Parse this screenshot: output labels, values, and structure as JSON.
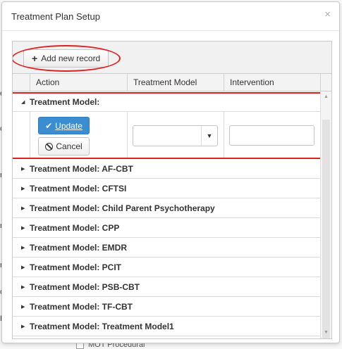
{
  "background": {
    "left_fragments": [
      "e",
      "c",
      "r",
      "n",
      "r",
      "o",
      "E"
    ],
    "bottom_label": "MOT Procedural"
  },
  "modal": {
    "title": "Treatment Plan Setup",
    "close_glyph": "×"
  },
  "toolbar": {
    "add_label": "Add new record",
    "add_glyph": "+"
  },
  "columns": [
    "Action",
    "Treatment Model",
    "Intervention"
  ],
  "edit_group": {
    "label": "Treatment Model:",
    "update_label": "Update",
    "update_glyph": "✔",
    "cancel_label": "Cancel",
    "dropdown_value": "",
    "dropdown_arrow": "▼",
    "intervention_value": ""
  },
  "groups": [
    "Treatment Model: AF-CBT",
    "Treatment Model: CFTSI",
    "Treatment Model: Child Parent Psychotherapy",
    "Treatment Model: CPP",
    "Treatment Model: EMDR",
    "Treatment Model: PCIT",
    "Treatment Model: PSB-CBT",
    "Treatment Model: TF-CBT",
    "Treatment Model: Treatment Model1"
  ],
  "icons": {
    "expanded": "◢",
    "collapsed": "▶",
    "scroll_up": "▲",
    "scroll_down": "▼"
  },
  "colors": {
    "accent_blue": "#3a8dd0",
    "annotation_red": "#e02020"
  }
}
